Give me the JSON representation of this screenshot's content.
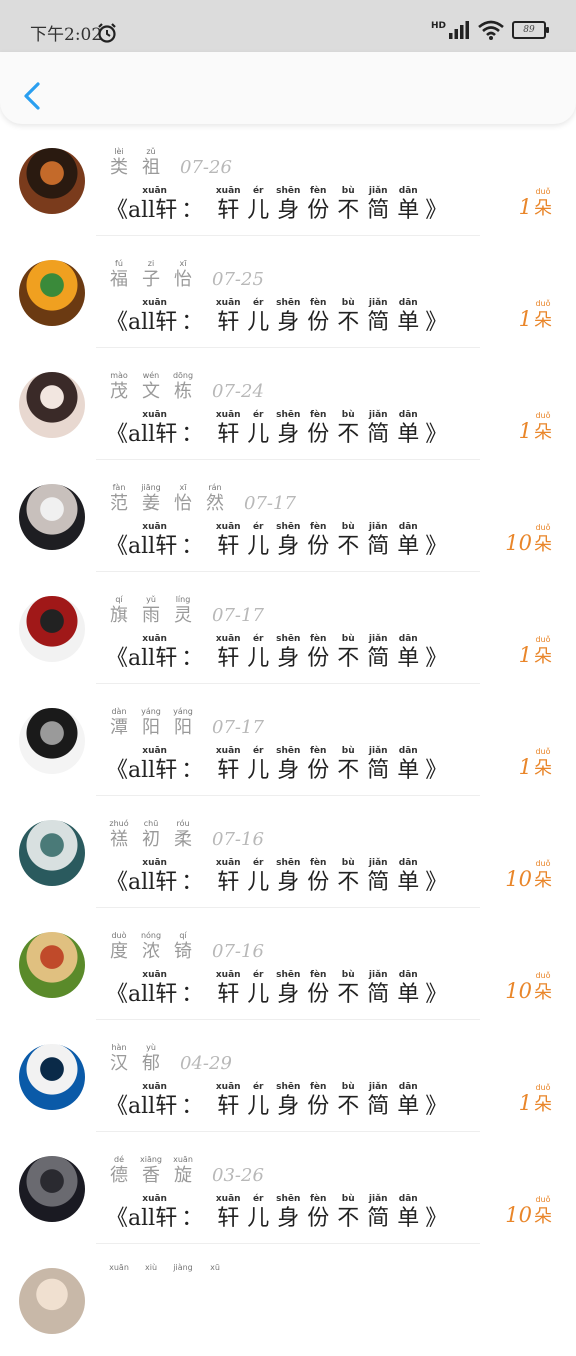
{
  "status_bar": {
    "time": "下午2:02",
    "hd": "HD",
    "battery": "89"
  },
  "header": {
    "back_icon": "chevron-left-icon"
  },
  "title": {
    "open": "《",
    "prefix": "all轩",
    "colon": "：",
    "close": "》",
    "chars": [
      {
        "py": "xuān",
        "hz": "轩"
      },
      {
        "py": "ér",
        "hz": "儿"
      },
      {
        "py": "shēn",
        "hz": "身"
      },
      {
        "py": "fèn",
        "hz": "份"
      },
      {
        "py": "bù",
        "hz": "不"
      },
      {
        "py": "jiǎn",
        "hz": "简"
      },
      {
        "py": "dān",
        "hz": "单"
      }
    ],
    "prefix_py": "xuān"
  },
  "unit": {
    "py": "duǒ",
    "hz": "朵"
  },
  "rows": [
    {
      "name": [
        {
          "py": "lèi",
          "hz": "类"
        },
        {
          "py": "zǔ",
          "hz": "祖"
        }
      ],
      "date": "07-26",
      "count": "1",
      "colors": [
        "#7a3b1c",
        "#2a1a10",
        "#c46a2a"
      ]
    },
    {
      "name": [
        {
          "py": "fú",
          "hz": "福"
        },
        {
          "py": "zi",
          "hz": "子"
        },
        {
          "py": "xī",
          "hz": "怡"
        }
      ],
      "date": "07-25",
      "count": "1",
      "colors": [
        "#6b3a12",
        "#f0a020",
        "#3a8a3a"
      ]
    },
    {
      "name": [
        {
          "py": "mào",
          "hz": "茂"
        },
        {
          "py": "wén",
          "hz": "文"
        },
        {
          "py": "dōng",
          "hz": "栋"
        }
      ],
      "date": "07-24",
      "count": "1",
      "colors": [
        "#e8d8d0",
        "#3a2a28",
        "#f2e6e0"
      ]
    },
    {
      "name": [
        {
          "py": "fàn",
          "hz": "范"
        },
        {
          "py": "jiāng",
          "hz": "姜"
        },
        {
          "py": "xī",
          "hz": "怡"
        },
        {
          "py": "rán",
          "hz": "然"
        }
      ],
      "date": "07-17",
      "count": "10",
      "colors": [
        "#1e1e22",
        "#c8c0bc",
        "#f0f0f0"
      ]
    },
    {
      "name": [
        {
          "py": "qí",
          "hz": "旗"
        },
        {
          "py": "yǔ",
          "hz": "雨"
        },
        {
          "py": "líng",
          "hz": "灵"
        }
      ],
      "date": "07-17",
      "count": "1",
      "colors": [
        "#f2f2f2",
        "#a01818",
        "#222222"
      ]
    },
    {
      "name": [
        {
          "py": "dàn",
          "hz": "潭"
        },
        {
          "py": "yáng",
          "hz": "阳"
        },
        {
          "py": "yáng",
          "hz": "阳"
        }
      ],
      "date": "07-17",
      "count": "1",
      "colors": [
        "#f4f4f4",
        "#1a1a1a",
        "#9a9a9a"
      ]
    },
    {
      "name": [
        {
          "py": "zhuó",
          "hz": "禚"
        },
        {
          "py": "chū",
          "hz": "初"
        },
        {
          "py": "róu",
          "hz": "柔"
        }
      ],
      "date": "07-16",
      "count": "10",
      "colors": [
        "#2a5a5e",
        "#d8e0e0",
        "#4a7a78"
      ]
    },
    {
      "name": [
        {
          "py": "duò",
          "hz": "度"
        },
        {
          "py": "nóng",
          "hz": "浓"
        },
        {
          "py": "qí",
          "hz": "锜"
        }
      ],
      "date": "07-16",
      "count": "10",
      "colors": [
        "#5a8a2a",
        "#e0c080",
        "#c04a2a"
      ]
    },
    {
      "name": [
        {
          "py": "hàn",
          "hz": "汉"
        },
        {
          "py": "yù",
          "hz": "郁"
        }
      ],
      "date": "04-29",
      "count": "1",
      "colors": [
        "#0a5aa8",
        "#f2f2f2",
        "#0a2a48"
      ]
    },
    {
      "name": [
        {
          "py": "dé",
          "hz": "德"
        },
        {
          "py": "xiāng",
          "hz": "香"
        },
        {
          "py": "xuān",
          "hz": "旋"
        }
      ],
      "date": "03-26",
      "count": "10",
      "colors": [
        "#1a1a22",
        "#6a6a70",
        "#2a2a30"
      ]
    }
  ],
  "partial_row": {
    "name": [
      {
        "py": "xuān",
        "hz": ""
      },
      {
        "py": "xiù",
        "hz": ""
      },
      {
        "py": "jiàng",
        "hz": ""
      },
      {
        "py": "xū",
        "hz": ""
      }
    ]
  }
}
